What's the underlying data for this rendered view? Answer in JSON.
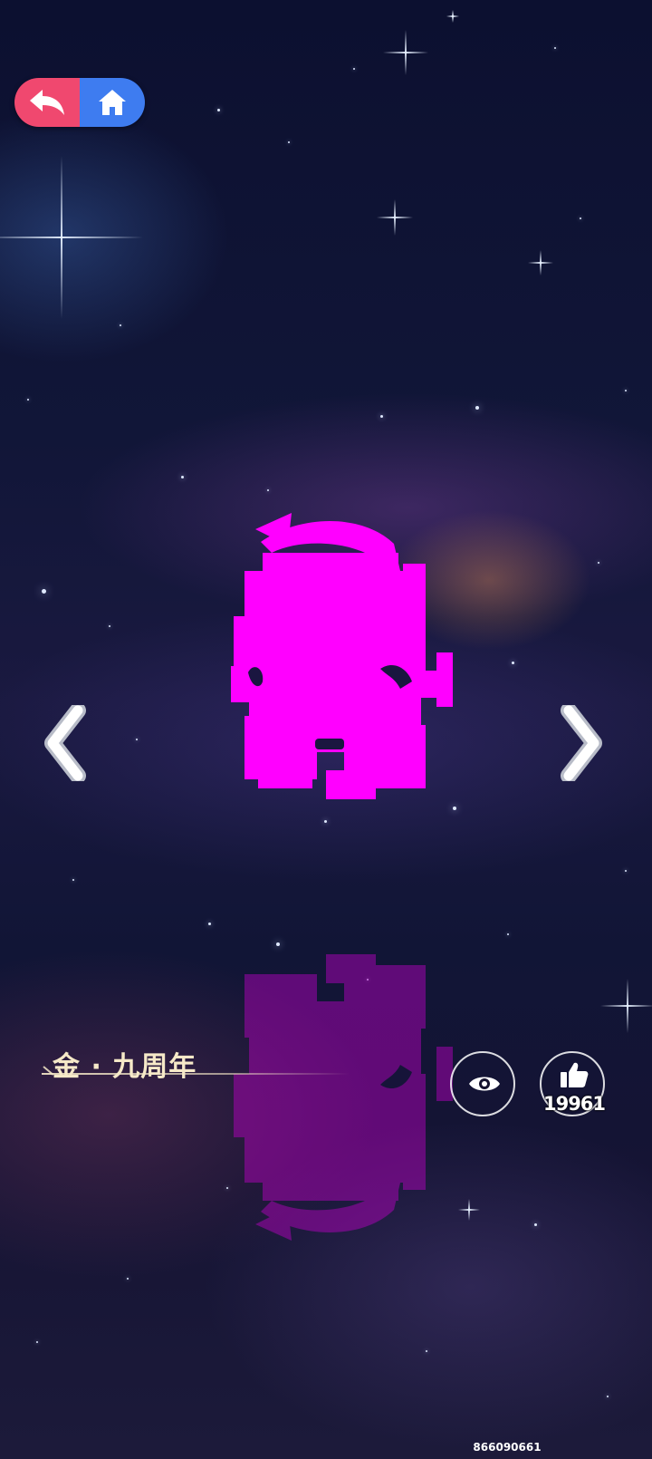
{
  "app": {
    "skin_name": "金 · 九周年",
    "like_count": "19961",
    "user_id": "866090661"
  },
  "icons": {
    "back": "back-arrow-icon",
    "home": "home-icon",
    "prev": "chevron-left-icon",
    "next": "chevron-right-icon",
    "view": "eye-icon",
    "like": "thumbs-up-icon"
  },
  "colors": {
    "back_button": "#f0486f",
    "home_button": "#3e7cf0",
    "avatar": "#ff00ff",
    "name_text": "#f6e9c8"
  }
}
